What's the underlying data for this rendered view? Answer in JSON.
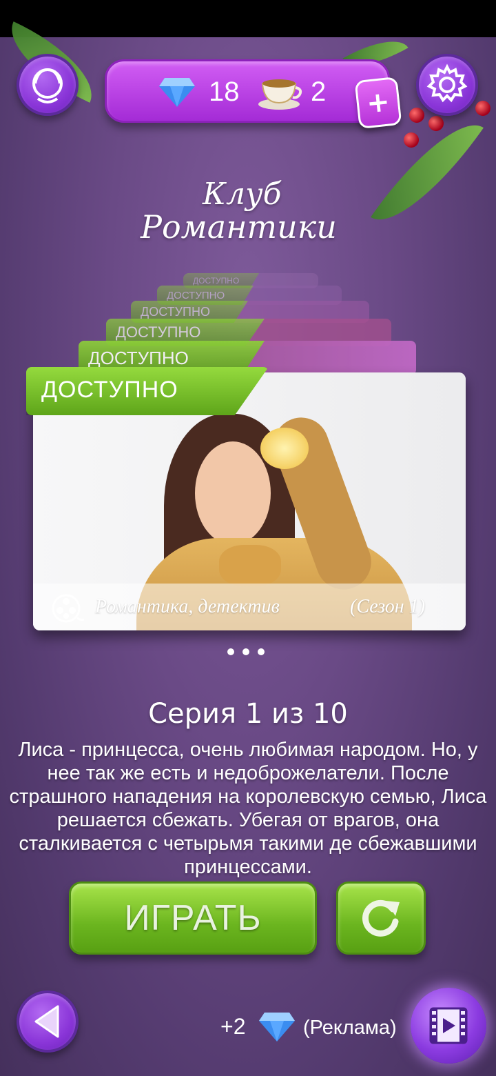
{
  "currency": {
    "gems": "18",
    "tea": "2",
    "plus_label": "+"
  },
  "logo": {
    "line1": "Клуб",
    "line2": "Романтики"
  },
  "stack_tags": [
    "ДОСТУПНО",
    "ДОСТУПНО",
    "ДОСТУПНО",
    "ДОСТУПНО",
    "ДОСТУПНО"
  ],
  "main_card": {
    "tag": "ДОСТУПНО",
    "genre": "Романтика, детектив",
    "season": "(Сезон 1)"
  },
  "episode": "Серия 1 из 10",
  "description": "Лиса - принцесса, очень любимая народом. Но, у нее так же есть и недоброжелатели. После страшного нападения на королевскую семью, Лиса решается сбежать. Убегая от врагов, она сталкивается с четырьмя такими де сбежавшими принцессами.",
  "buttons": {
    "play": "ИГРАТЬ"
  },
  "ad": {
    "reward": "+2",
    "label": "(Реклама)"
  },
  "colors": {
    "accent_purple": "#a42bd6",
    "play_green": "#6bb51f",
    "tag_green": "#5fa21c"
  },
  "icons": [
    "profile-icon",
    "gem-icon",
    "tea-cup-icon",
    "settings-gear-icon",
    "film-reel-icon",
    "restart-icon",
    "back-arrow-icon",
    "video-ad-icon"
  ]
}
